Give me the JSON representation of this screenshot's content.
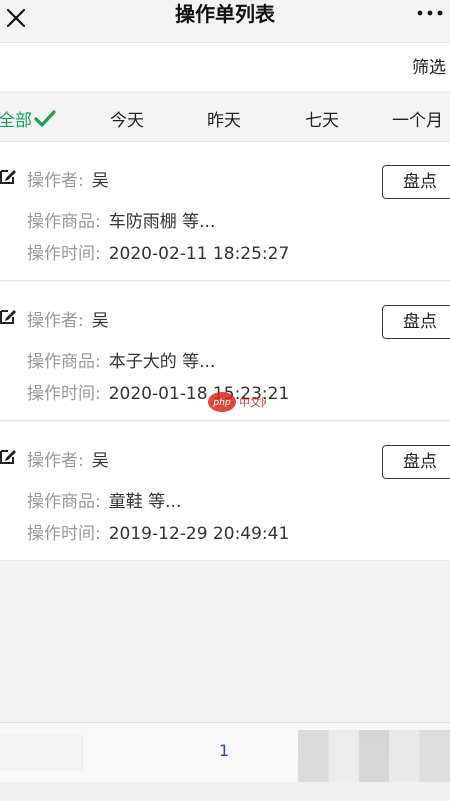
{
  "navbar": {
    "title": "操作单列表",
    "close_icon": "close-icon",
    "more_icon": "more-icon"
  },
  "filter": {
    "label": "筛选"
  },
  "tabs": [
    {
      "label": "全部",
      "active": true
    },
    {
      "label": "今天",
      "active": false
    },
    {
      "label": "昨天",
      "active": false
    },
    {
      "label": "七天",
      "active": false
    },
    {
      "label": "一个月",
      "active": false
    }
  ],
  "labels": {
    "operator": "操作者:",
    "goods": "操作商品:",
    "time": "操作时间:",
    "count_button": "盘点"
  },
  "items": [
    {
      "operator": "吴",
      "goods": "车防雨棚 等...",
      "time": "2020-02-11 18:25:27"
    },
    {
      "operator": "吴",
      "goods": "本子大的 等...",
      "time": "2020-01-18 15:23:21"
    },
    {
      "operator": "吴",
      "goods": "童鞋 等...",
      "time": "2019-12-29 20:49:41"
    }
  ],
  "pager": {
    "current_page": "1"
  },
  "colors": {
    "accent": "#1aa05a",
    "page_link": "#1c4fa0"
  }
}
